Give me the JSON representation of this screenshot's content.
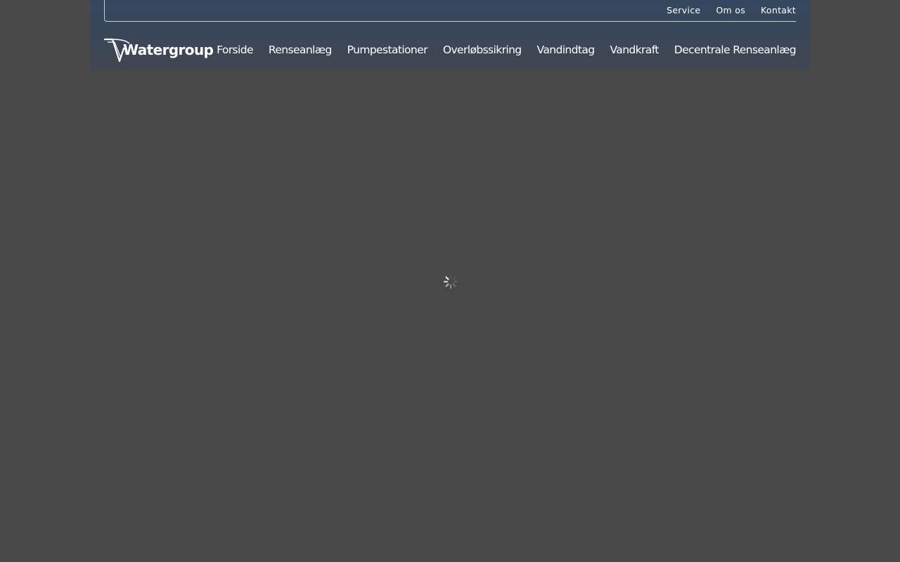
{
  "top_nav": {
    "items": [
      {
        "label": "Service"
      },
      {
        "label": "Om os"
      },
      {
        "label": "Kontakt"
      }
    ]
  },
  "brand": {
    "logo_text": "Watergroup"
  },
  "main_nav": {
    "items": [
      {
        "label": "Forside"
      },
      {
        "label": "Renseanlæg"
      },
      {
        "label": "Pumpestationer"
      },
      {
        "label": "Overløbssikring"
      },
      {
        "label": "Vandindtag"
      },
      {
        "label": "Vandkraft"
      },
      {
        "label": "Decentrale Renseanlæg"
      }
    ]
  },
  "loading": {
    "icon": "loading-spinner-icon"
  },
  "colors": {
    "page_background": "#484848",
    "header_background": "#354760",
    "text": "#ffffff"
  }
}
